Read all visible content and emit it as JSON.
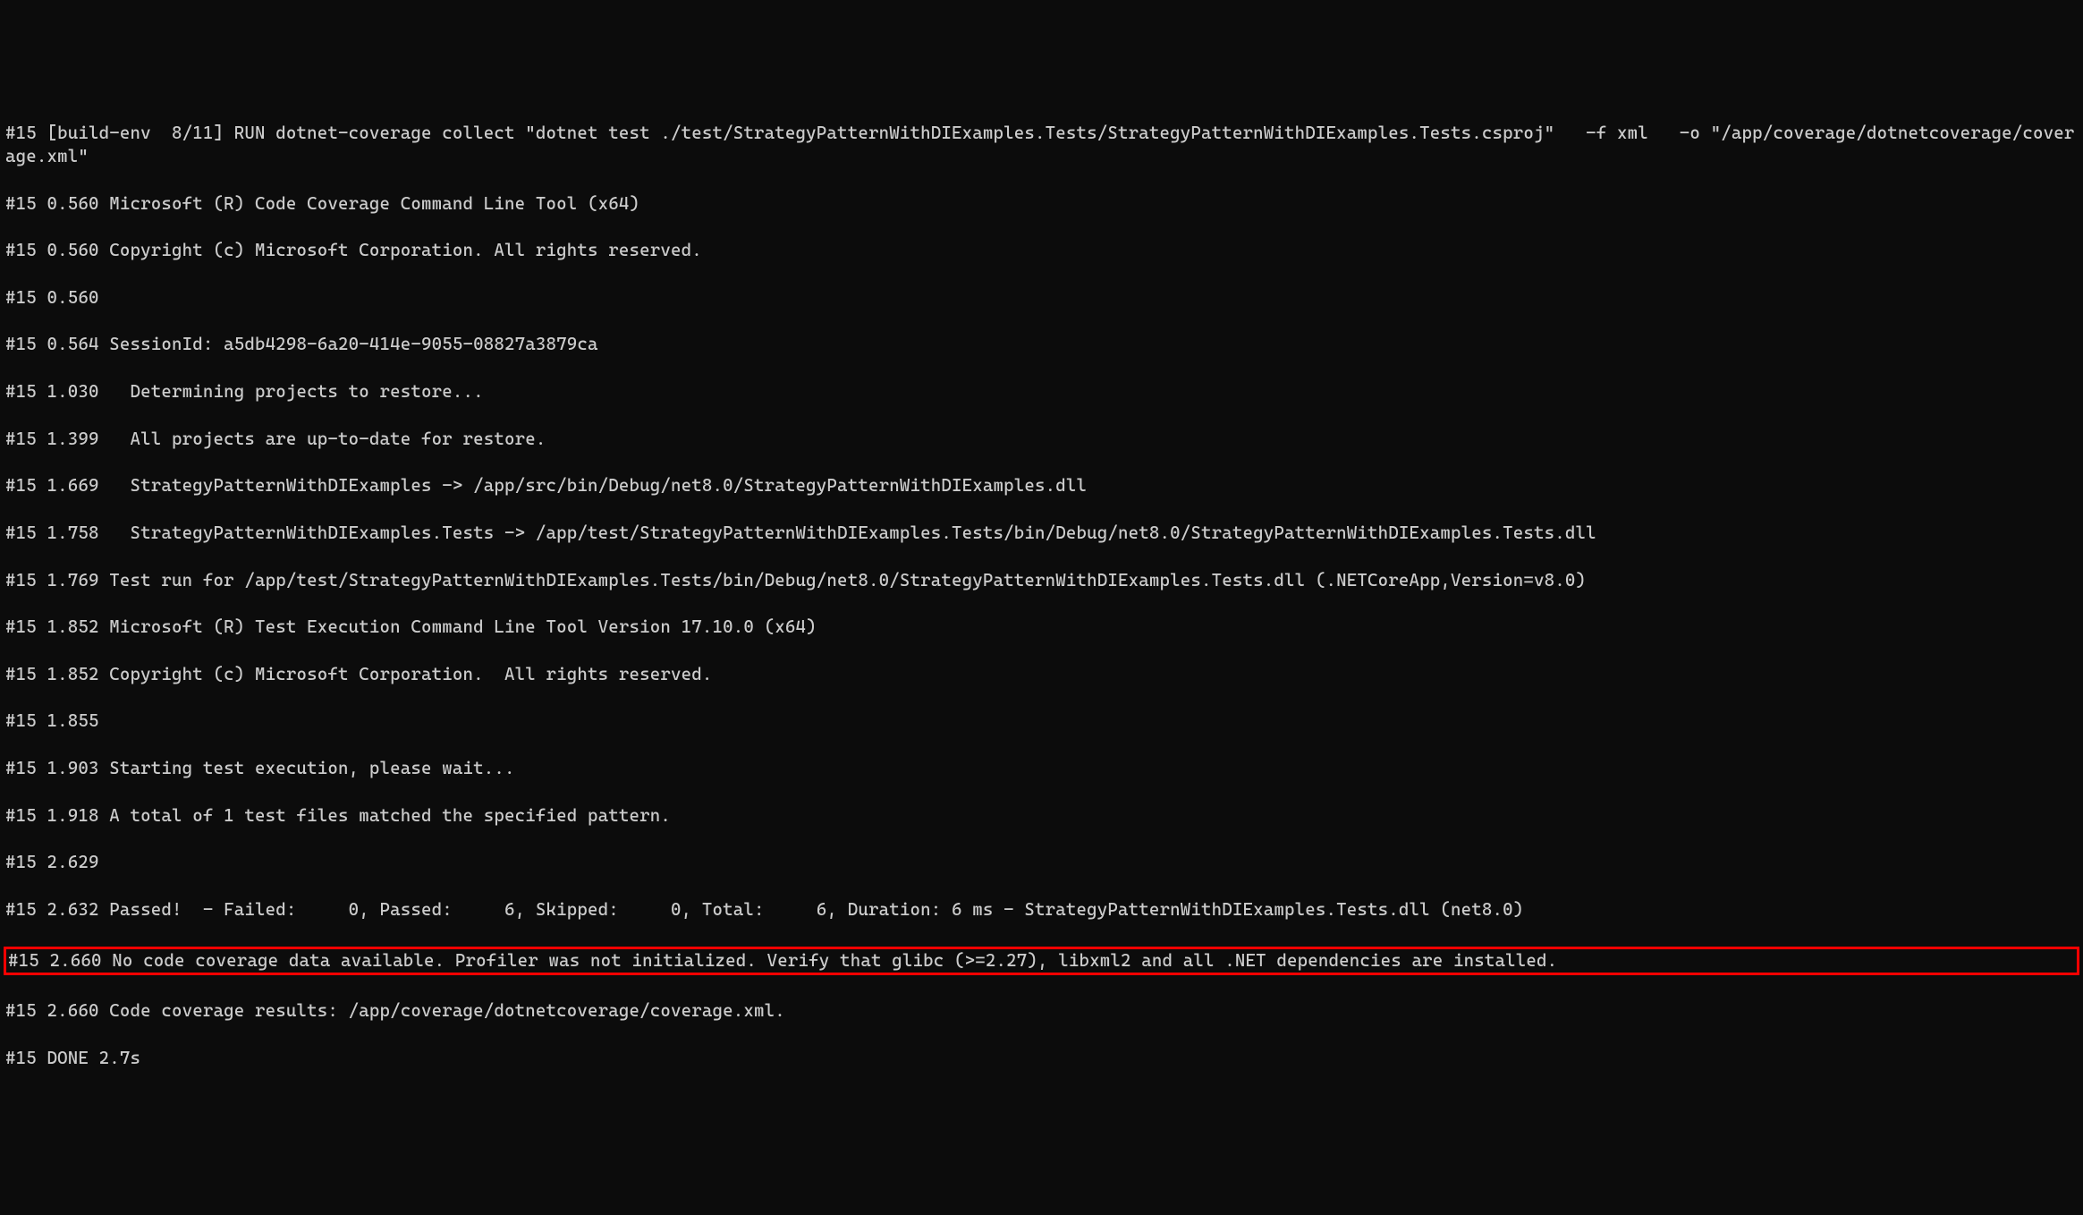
{
  "terminal": {
    "lines": [
      "#15 [build-env  8/11] RUN dotnet-coverage collect \"dotnet test ./test/StrategyPatternWithDIExamples.Tests/StrategyPatternWithDIExamples.Tests.csproj\"   -f xml   -o \"/app/coverage/dotnetcoverage/coverage.xml\"",
      "#15 0.560 Microsoft (R) Code Coverage Command Line Tool (x64)",
      "#15 0.560 Copyright (c) Microsoft Corporation. All rights reserved.",
      "#15 0.560",
      "#15 0.564 SessionId: a5db4298-6a20-414e-9055-08827a3879ca",
      "#15 1.030   Determining projects to restore...",
      "#15 1.399   All projects are up-to-date for restore.",
      "#15 1.669   StrategyPatternWithDIExamples -> /app/src/bin/Debug/net8.0/StrategyPatternWithDIExamples.dll",
      "#15 1.758   StrategyPatternWithDIExamples.Tests -> /app/test/StrategyPatternWithDIExamples.Tests/bin/Debug/net8.0/StrategyPatternWithDIExamples.Tests.dll",
      "#15 1.769 Test run for /app/test/StrategyPatternWithDIExamples.Tests/bin/Debug/net8.0/StrategyPatternWithDIExamples.Tests.dll (.NETCoreApp,Version=v8.0)",
      "#15 1.852 Microsoft (R) Test Execution Command Line Tool Version 17.10.0 (x64)",
      "#15 1.852 Copyright (c) Microsoft Corporation.  All rights reserved.",
      "#15 1.855",
      "#15 1.903 Starting test execution, please wait...",
      "#15 1.918 A total of 1 test files matched the specified pattern.",
      "#15 2.629",
      "#15 2.632 Passed!  - Failed:     0, Passed:     6, Skipped:     0, Total:     6, Duration: 6 ms - StrategyPatternWithDIExamples.Tests.dll (net8.0)"
    ],
    "highlighted": "#15 2.660 No code coverage data available. Profiler was not initialized. Verify that glibc (>=2.27), libxml2 and all .NET dependencies are installed.",
    "after": [
      "#15 2.660 Code coverage results: /app/coverage/dotnetcoverage/coverage.xml.",
      "#15 DONE 2.7s"
    ]
  }
}
